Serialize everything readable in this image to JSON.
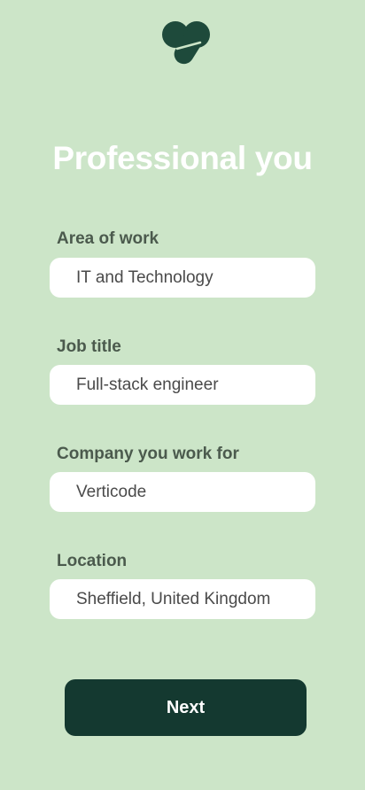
{
  "brand": {
    "logo_icon": "verticode-logo-icon",
    "logo_color": "#1e4a3b"
  },
  "page": {
    "title": "Professional you",
    "background": "#cce5c8"
  },
  "form": {
    "area_of_work": {
      "label": "Area of work",
      "value": "IT and Technology"
    },
    "job_title": {
      "label": "Job title",
      "value": "Full-stack engineer"
    },
    "company": {
      "label": "Company you work for",
      "value": "Verticode"
    },
    "location": {
      "label": "Location",
      "value": "Sheffield, United Kingdom"
    }
  },
  "actions": {
    "next_label": "Next",
    "next_color": "#143930"
  }
}
